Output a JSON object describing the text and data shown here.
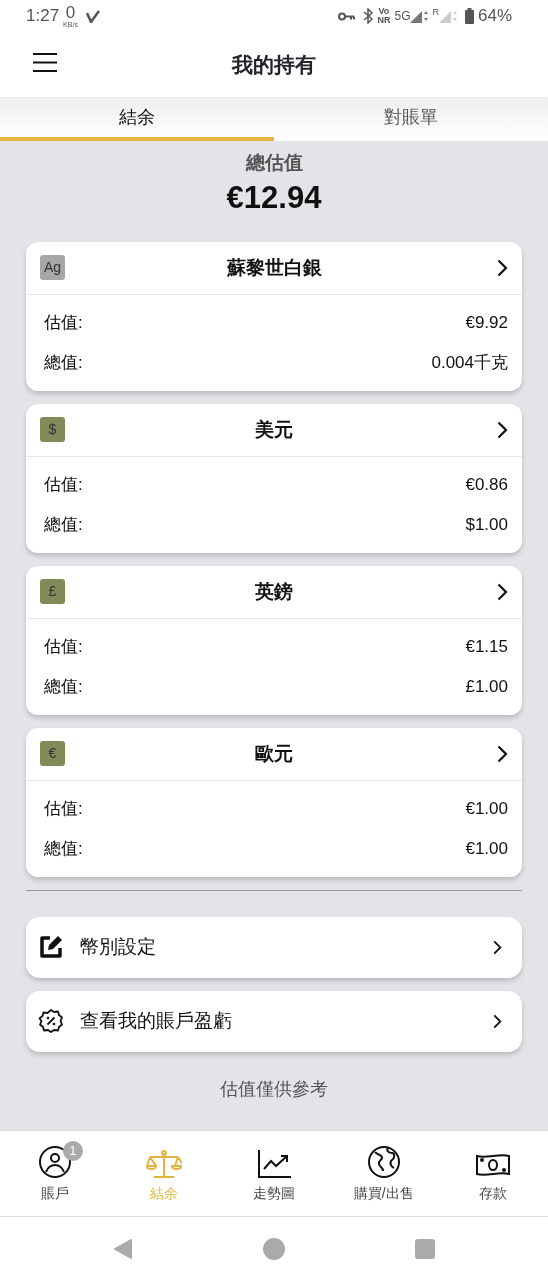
{
  "status_bar": {
    "time": "1:27",
    "net_speed": "0",
    "net_unit": "KB/s",
    "volte_top": "Vo",
    "volte_bottom": "NR",
    "network": "5G",
    "roaming": "R",
    "battery": "64%"
  },
  "app_bar": {
    "title": "我的持有"
  },
  "tabs": [
    {
      "label": "結余",
      "selected": true
    },
    {
      "label": "對賬單",
      "selected": false
    }
  ],
  "summary": {
    "label": "總估值",
    "value": "€12.94"
  },
  "holdings": [
    {
      "symbol": "Ag",
      "color": "#a6a6a6",
      "name": "蘇黎世白銀",
      "rows": [
        {
          "label": "估值:",
          "value": "€9.92"
        },
        {
          "label": "總值:",
          "value": "0.004千克"
        }
      ]
    },
    {
      "symbol": "$",
      "color": "#7f8c5a",
      "name": "美元",
      "rows": [
        {
          "label": "估值:",
          "value": "€0.86"
        },
        {
          "label": "總值:",
          "value": "$1.00"
        }
      ]
    },
    {
      "symbol": "£",
      "color": "#7f8c5a",
      "name": "英鎊",
      "rows": [
        {
          "label": "估值:",
          "value": "€1.15"
        },
        {
          "label": "總值:",
          "value": "£1.00"
        }
      ]
    },
    {
      "symbol": "€",
      "color": "#7f8c5a",
      "name": "歐元",
      "rows": [
        {
          "label": "估值:",
          "value": "€1.00"
        },
        {
          "label": "總值:",
          "value": "€1.00"
        }
      ]
    }
  ],
  "actions": [
    {
      "kind": "edit",
      "label": "幣別設定"
    },
    {
      "kind": "percent",
      "label": "查看我的賬戶盈虧"
    }
  ],
  "footnote": "估值僅供參考",
  "bottom_nav": [
    {
      "kind": "account",
      "label": "賬戶",
      "badge": "1",
      "selected": false
    },
    {
      "kind": "balance",
      "label": "結余",
      "selected": true
    },
    {
      "kind": "chart",
      "label": "走勢圖",
      "selected": false
    },
    {
      "kind": "globe",
      "label": "購買/出售",
      "selected": false
    },
    {
      "kind": "cash",
      "label": "存款",
      "selected": false
    }
  ]
}
